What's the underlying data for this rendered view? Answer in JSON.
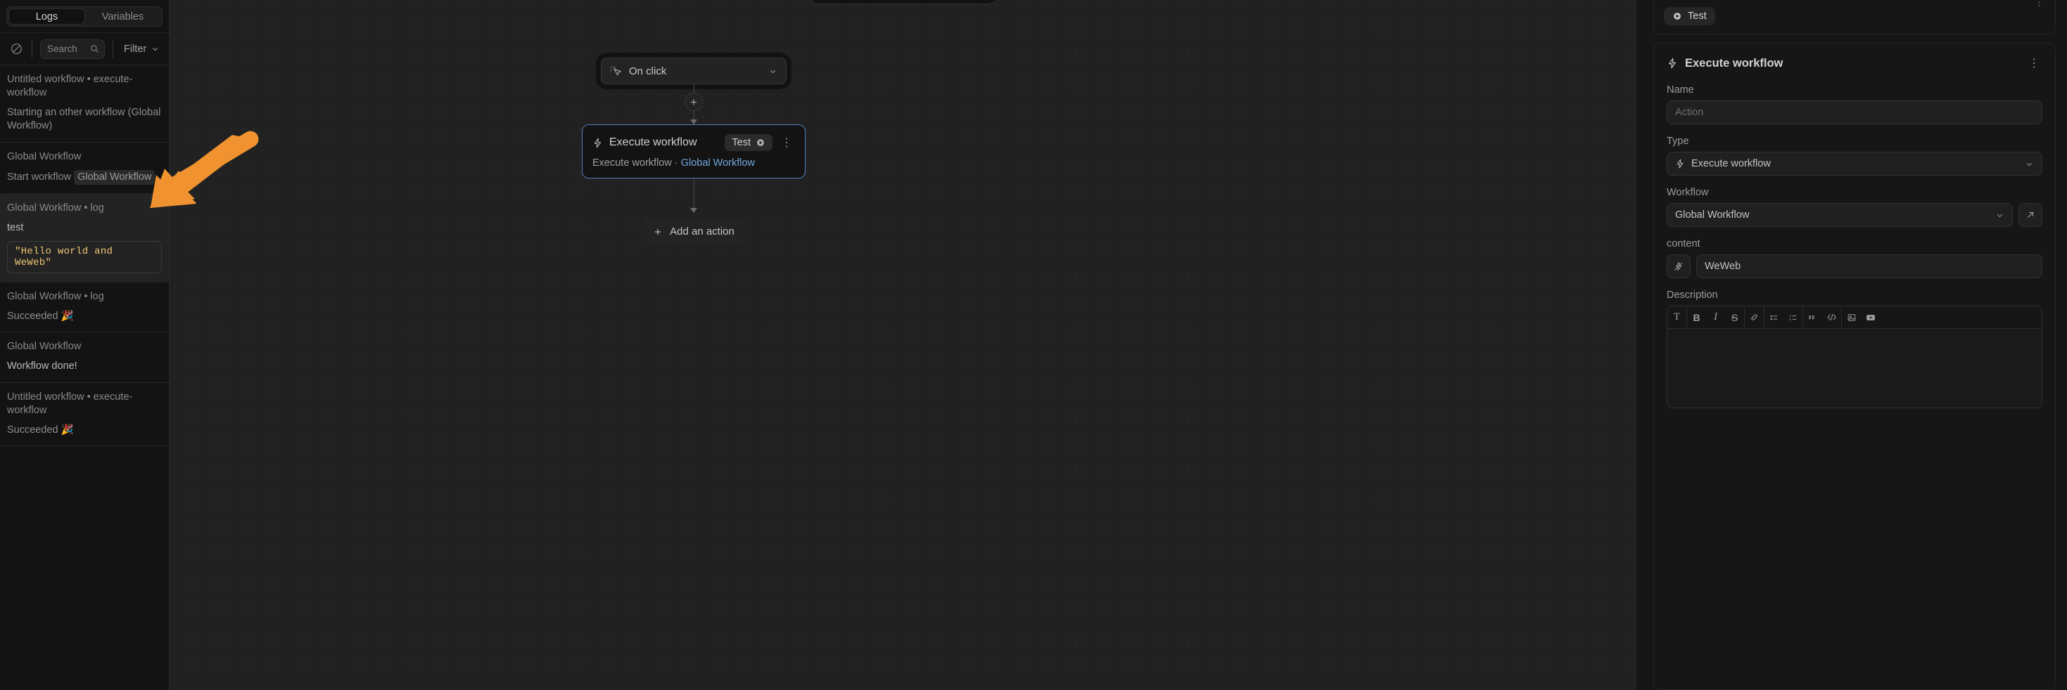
{
  "sidebar": {
    "tabs": [
      {
        "label": "Logs",
        "active": true
      },
      {
        "label": "Variables",
        "active": false
      }
    ],
    "toolbar": {
      "clear_icon": "no-entry-icon",
      "search_placeholder": "Search",
      "search_icon": "search-icon",
      "filter_label": "Filter",
      "filter_chevron": "chevron-down-icon"
    },
    "logs": [
      {
        "source": "Untitled workflow • execute-workflow",
        "message": "Starting an other workflow (Global Workflow)",
        "highlight": false
      },
      {
        "source": "Global Workflow",
        "message": "Start workflow",
        "chip": "Global Workflow",
        "highlight": false
      },
      {
        "source": "Global Workflow • log",
        "message": "test",
        "value": "\"Hello world and WeWeb\"",
        "highlight": true
      },
      {
        "source": "Global Workflow • log",
        "message": "Succeeded 🎉",
        "highlight": false
      },
      {
        "source": "Global Workflow",
        "message": "Workflow done!",
        "highlight": false
      },
      {
        "source": "Untitled workflow • execute-workflow",
        "message": "Succeeded 🎉",
        "highlight": false
      }
    ]
  },
  "canvas": {
    "trigger": {
      "icon": "cursor-click-icon",
      "label": "On click",
      "chevron": "chevron-down-icon"
    },
    "add_step_icon": "plus-icon",
    "action": {
      "icon": "lightning-bolt-icon",
      "title": "Execute workflow",
      "test_label": "Test",
      "test_icon": "play-circle-icon",
      "menu_icon": "kebab-menu-icon",
      "subtitle_prefix": "Execute workflow · ",
      "subtitle_link": "Global Workflow"
    },
    "add_action": {
      "icon": "plus-icon",
      "label": "Add an action"
    }
  },
  "right_panel": {
    "test_button": {
      "icon": "play-circle-icon",
      "label": "Test"
    },
    "header": {
      "icon": "lightning-bolt-icon",
      "title": "Execute workflow",
      "menu_icon": "kebab-menu-icon"
    },
    "fields": {
      "name_label": "Name",
      "name_placeholder": "Action",
      "type_label": "Type",
      "type_icon": "lightning-bolt-icon",
      "type_value": "Execute workflow",
      "type_chevron": "chevron-down-icon",
      "workflow_label": "Workflow",
      "workflow_value": "Global Workflow",
      "workflow_chevron": "chevron-down-icon",
      "workflow_open_icon": "external-link-icon",
      "content_label": "content",
      "content_bind_icon": "plug-bolt-icon",
      "content_value": "WeWeb",
      "description_label": "Description"
    },
    "rte_toolbar": [
      {
        "icon": "text-format-icon",
        "glyph": "T"
      },
      {
        "icon": "bold-icon",
        "glyph": "B"
      },
      {
        "icon": "italic-icon",
        "glyph": "I"
      },
      {
        "icon": "strikethrough-icon",
        "glyph": "S"
      },
      {
        "icon": "link-icon",
        "glyph": "🔗"
      },
      {
        "icon": "bullet-list-icon",
        "glyph": "☰"
      },
      {
        "icon": "numbered-list-icon",
        "glyph": "≡"
      },
      {
        "icon": "quote-icon",
        "glyph": "❝"
      },
      {
        "icon": "code-icon",
        "glyph": "</>"
      },
      {
        "icon": "image-icon",
        "glyph": "🖼"
      },
      {
        "icon": "video-icon",
        "glyph": "▶"
      }
    ]
  },
  "annotation": {
    "arrow_color": "#f0922f",
    "arrow_name": "pointer-arrow"
  }
}
